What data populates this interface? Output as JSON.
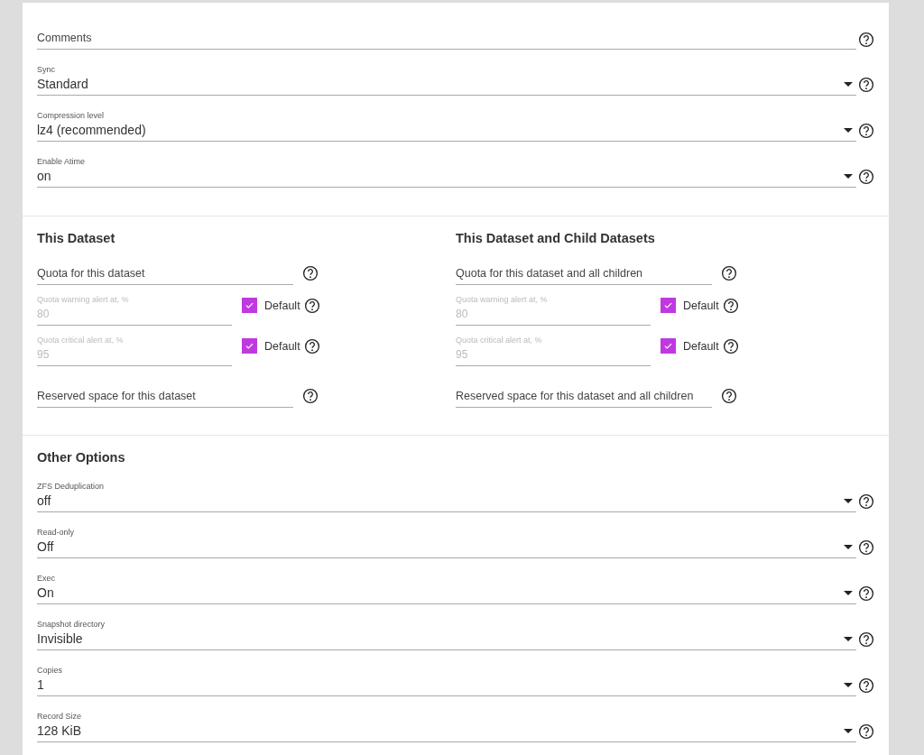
{
  "general": [
    {
      "kind": "text",
      "placeholder": "Comments"
    },
    {
      "kind": "select",
      "label": "Sync",
      "value": "Standard"
    },
    {
      "kind": "select",
      "label": "Compression level",
      "value": "lz4 (recommended)"
    },
    {
      "kind": "select",
      "label": "Enable Atime",
      "value": "on"
    }
  ],
  "quota_columns": [
    {
      "title": "This Dataset",
      "fields": [
        {
          "kind": "text",
          "placeholder": "Quota for this dataset"
        },
        {
          "kind": "alert",
          "label": "Quota warning alert at, %",
          "value": "80",
          "disabled": true,
          "checkbox_label": "Default",
          "checked": true
        },
        {
          "kind": "alert",
          "label": "Quota critical alert at, %",
          "value": "95",
          "disabled": true,
          "checkbox_label": "Default",
          "checked": true
        },
        {
          "kind": "text",
          "placeholder": "Reserved space for this dataset"
        }
      ]
    },
    {
      "title": "This Dataset and Child Datasets",
      "fields": [
        {
          "kind": "text",
          "placeholder": "Quota for this dataset and all children"
        },
        {
          "kind": "alert",
          "label": "Quota warning alert at, %",
          "value": "80",
          "disabled": true,
          "checkbox_label": "Default",
          "checked": true
        },
        {
          "kind": "alert",
          "label": "Quota critical alert at, %",
          "value": "95",
          "disabled": true,
          "checkbox_label": "Default",
          "checked": true
        },
        {
          "kind": "text",
          "placeholder": "Reserved space for this dataset and all children"
        }
      ]
    }
  ],
  "other_options": {
    "title": "Other Options",
    "fields": [
      {
        "kind": "select",
        "label": "ZFS Deduplication",
        "value": "off"
      },
      {
        "kind": "select",
        "label": "Read-only",
        "value": "Off"
      },
      {
        "kind": "select",
        "label": "Exec",
        "value": "On"
      },
      {
        "kind": "select",
        "label": "Snapshot directory",
        "value": "Invisible"
      },
      {
        "kind": "select",
        "label": "Copies",
        "value": "1"
      },
      {
        "kind": "select",
        "label": "Record Size",
        "value": "128 KiB"
      }
    ]
  }
}
